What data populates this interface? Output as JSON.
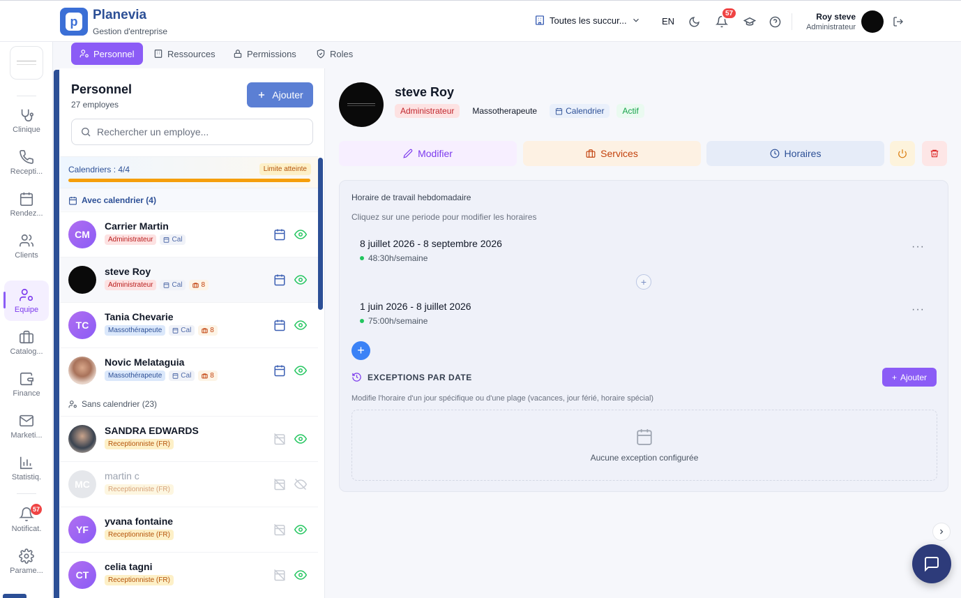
{
  "app": {
    "name": "Planevia",
    "subtitle": "Gestion d'entreprise",
    "logo_letter": "p"
  },
  "header": {
    "branch": "Toutes les succur...",
    "lang": "EN",
    "notif_count": "57",
    "user_name": "Roy steve",
    "user_role": "Administrateur"
  },
  "sidebar": {
    "items": [
      {
        "label": "Clinique",
        "icon": "stethoscope-icon"
      },
      {
        "label": "Recepti...",
        "icon": "phone-icon"
      },
      {
        "label": "Rendez...",
        "icon": "calendar-icon"
      },
      {
        "label": "Clients",
        "icon": "users-icon"
      },
      {
        "label": "Equipe",
        "icon": "team-icon",
        "active": true
      },
      {
        "label": "Catalog...",
        "icon": "briefcase-icon"
      },
      {
        "label": "Finance",
        "icon": "wallet-icon"
      },
      {
        "label": "Marketi...",
        "icon": "mail-icon"
      },
      {
        "label": "Statistiq.",
        "icon": "chart-icon"
      },
      {
        "label": "Notificat.",
        "icon": "bell-icon",
        "badge": "57"
      },
      {
        "label": "Parame...",
        "icon": "gear-icon"
      }
    ]
  },
  "tabs": [
    {
      "label": "Personnel",
      "icon": "user-cog-icon"
    },
    {
      "label": "Ressources",
      "icon": "building-icon"
    },
    {
      "label": "Permissions",
      "icon": "lock-icon"
    },
    {
      "label": "Roles",
      "icon": "shield-icon"
    }
  ],
  "list": {
    "title": "Personnel",
    "count": "27 employes",
    "add_label": "Ajouter",
    "search_placeholder": "Rechercher un employe...",
    "quota_label": "Calendriers : 4/4",
    "quota_limit": "Limite atteinte",
    "with_cal_label": "Avec calendrier (4)",
    "without_cal_label": "Sans calendrier (23)",
    "employees": [
      {
        "initials": "CM",
        "name": "Carrier Martin",
        "role": "Administrateur",
        "cal": "Cal",
        "services": ""
      },
      {
        "initials": "",
        "name": "steve Roy",
        "role": "Administrateur",
        "cal": "Cal",
        "services": "8"
      },
      {
        "initials": "TC",
        "name": "Tania Chevarie",
        "role": "Massothérapeute",
        "cal": "Cal",
        "services": "8"
      },
      {
        "initials": "",
        "name": "Novic Melataguia",
        "role": "Massothérapeute",
        "cal": "Cal",
        "services": "8"
      },
      {
        "initials": "",
        "name": "SANDRA EDWARDS",
        "role": "Receptionniste (FR)"
      },
      {
        "initials": "MC",
        "name": "martin c",
        "role": "Receptionniste (FR)"
      },
      {
        "initials": "YF",
        "name": "yvana fontaine",
        "role": "Receptionniste (FR)"
      },
      {
        "initials": "CT",
        "name": "celia tagni",
        "role": "Receptionniste (FR)"
      }
    ]
  },
  "detail": {
    "name": "steve Roy",
    "role": "Administrateur",
    "specialty": "Massotherapeute",
    "calendar": "Calendrier",
    "status": "Actif",
    "btn_modify": "Modifier",
    "btn_services": "Services",
    "btn_hours": "Horaires",
    "schedule_title": "Horaire de travail hebdomadaire",
    "schedule_hint": "Cliquez sur une periode pour modifier les horaires",
    "periods": [
      {
        "dates": "8 juillet 2026 - 8 septembre 2026",
        "hours": "48:30h/semaine"
      },
      {
        "dates": "1 juin 2026 - 8 juillet 2026",
        "hours": "75:00h/semaine"
      }
    ],
    "exceptions_title": "EXCEPTIONS PAR DATE",
    "exceptions_add": "Ajouter",
    "exceptions_hint": "Modifie l'horaire d'un jour spécifique ou d'une plage (vacances, jour férié, horaire spécial)",
    "exceptions_empty": "Aucune exception configurée"
  }
}
